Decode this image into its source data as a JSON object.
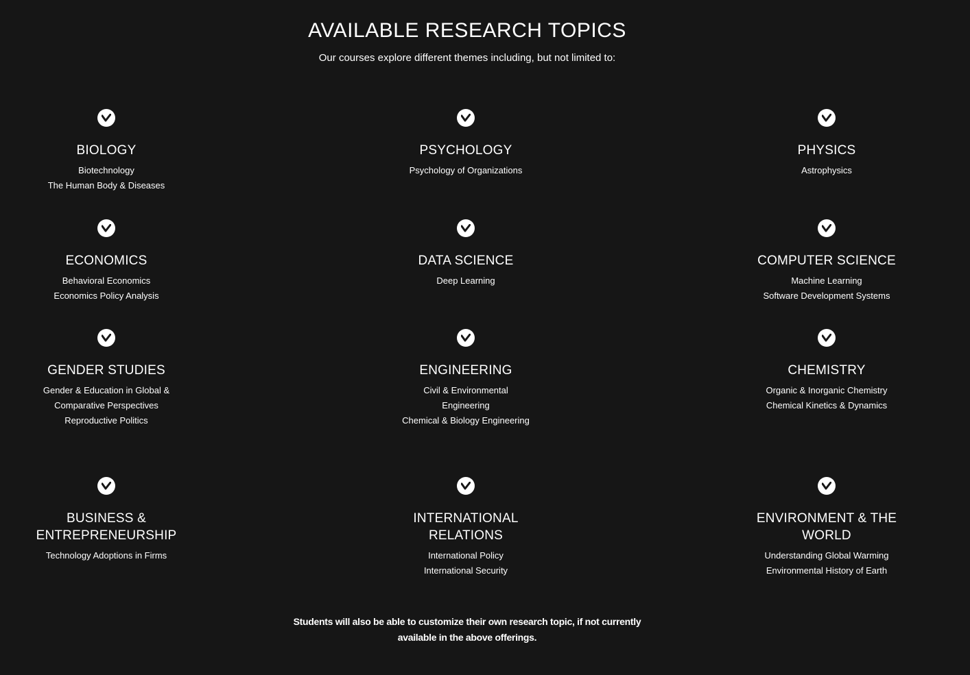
{
  "header": {
    "title": "AVAILABLE RESEARCH TOPICS",
    "subtitle": "Our courses explore different themes including, but not limited to:"
  },
  "icon": "check-circle-icon",
  "topics": [
    {
      "name": "BIOLOGY",
      "subs": [
        "Biotechnology",
        "The Human Body & Diseases"
      ]
    },
    {
      "name": "PSYCHOLOGY",
      "subs": [
        "Psychology of Organizations"
      ]
    },
    {
      "name": "PHYSICS",
      "subs": [
        "Astrophysics"
      ]
    },
    {
      "name": "ECONOMICS",
      "subs": [
        "Behavioral Economics",
        "Economics Policy Analysis"
      ]
    },
    {
      "name": "DATA SCIENCE",
      "subs": [
        "Deep Learning"
      ]
    },
    {
      "name": "COMPUTER SCIENCE",
      "subs": [
        "Machine Learning",
        "Software Development Systems"
      ]
    },
    {
      "name": "GENDER STUDIES",
      "subs": [
        "Gender & Education in Global &",
        "Comparative Perspectives",
        "Reproductive Politics"
      ]
    },
    {
      "name": "ENGINEERING",
      "subs": [
        "Civil & Environmental",
        "Engineering",
        "Chemical & Biology Engineering"
      ]
    },
    {
      "name": "CHEMISTRY",
      "subs": [
        "Organic & Inorganic Chemistry",
        "Chemical Kinetics & Dynamics"
      ]
    },
    {
      "name_lines": [
        "BUSINESS &",
        "ENTREPRENEURSHIP"
      ],
      "subs": [
        "Technology Adoptions in Firms"
      ]
    },
    {
      "name_lines": [
        "INTERNATIONAL",
        "RELATIONS"
      ],
      "subs": [
        "International Policy",
        "International Security"
      ]
    },
    {
      "name_lines": [
        "ENVIRONMENT & THE",
        "WORLD"
      ],
      "subs": [
        "Understanding Global Warming",
        "Environmental History of Earth"
      ]
    }
  ],
  "footer": {
    "line1": "Students will also be able to customize their own research topic, if not currently",
    "line2": "available in the above offerings."
  }
}
